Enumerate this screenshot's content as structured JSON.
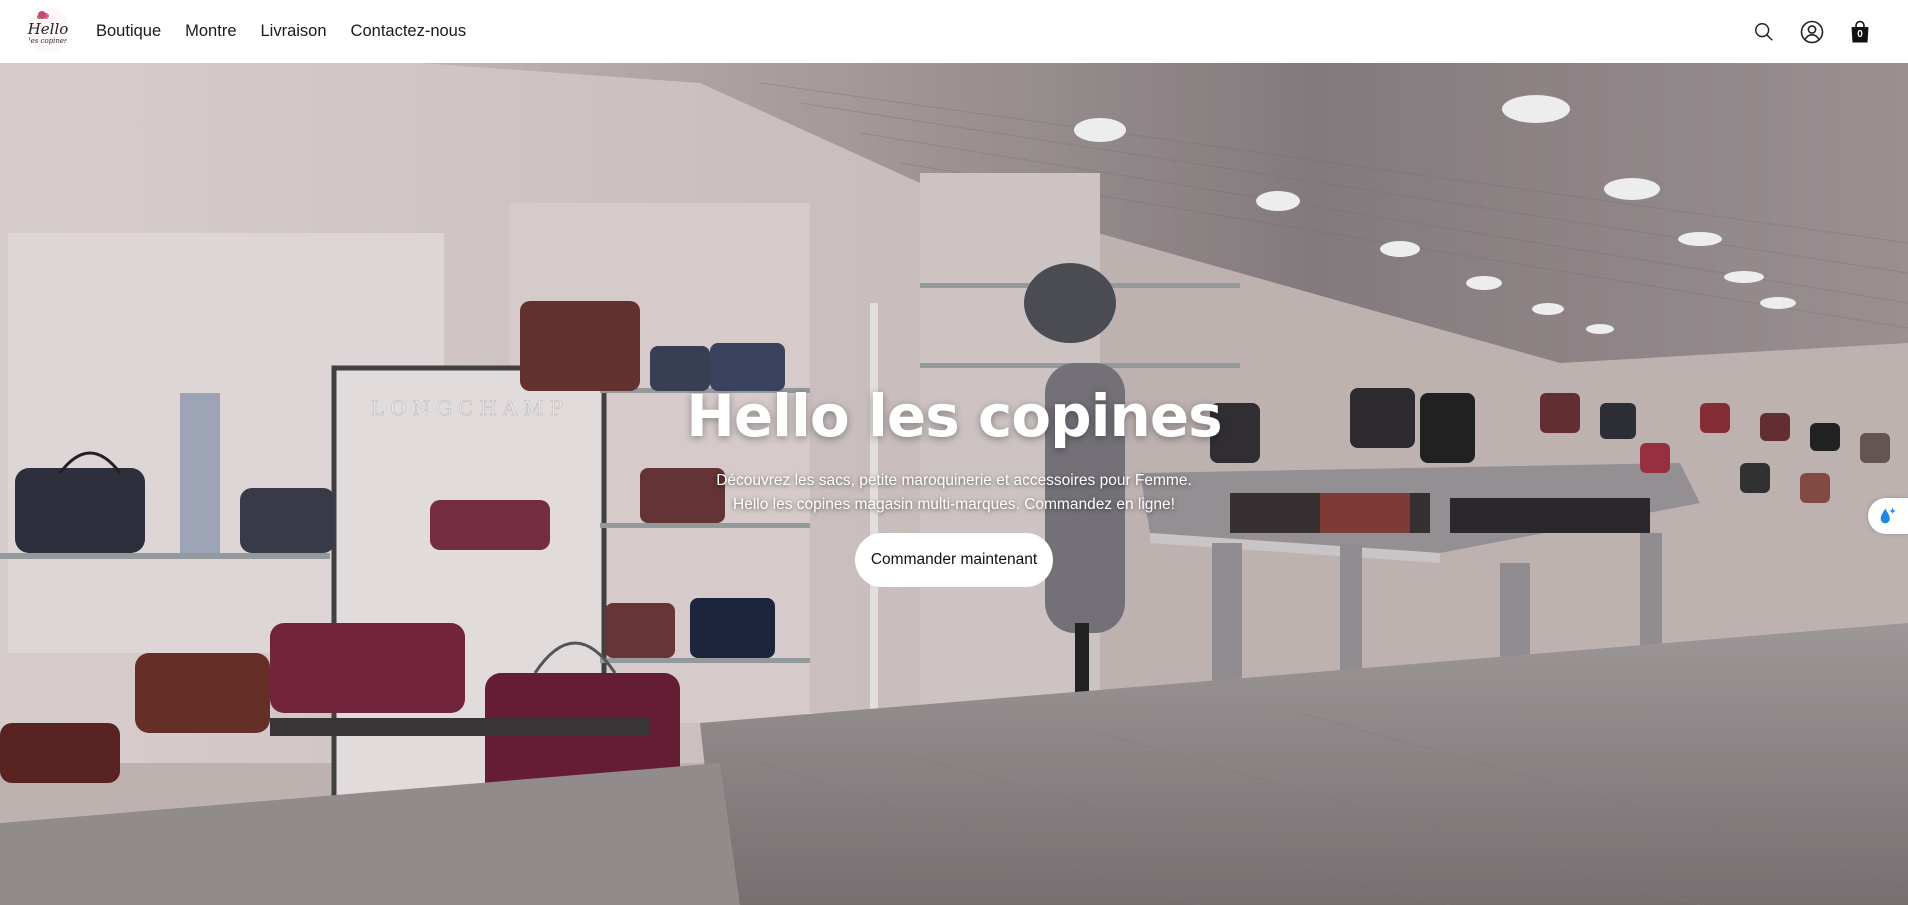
{
  "header": {
    "logo": {
      "line1": "Hello",
      "line2": "les copines"
    },
    "nav": [
      "Boutique",
      "Montre",
      "Livraison",
      "Contactez-nous"
    ],
    "icons": [
      "search-icon",
      "account-icon",
      "cart-icon"
    ],
    "cart_count": "0"
  },
  "hero": {
    "title": "Hello les copines",
    "subtitle_line1": "Découvrez les sacs, petite maroquinerie et accessoires pour Femme.",
    "subtitle_line2": "Hello les copines magasin multi-marques. Commandez en ligne!",
    "cta_label": "Commander maintenant",
    "sign_text": "LONGCHAMP"
  },
  "colors": {
    "accent": "#111111",
    "hero_bg": "#c9bdbd",
    "widget": "#1e88e5"
  }
}
